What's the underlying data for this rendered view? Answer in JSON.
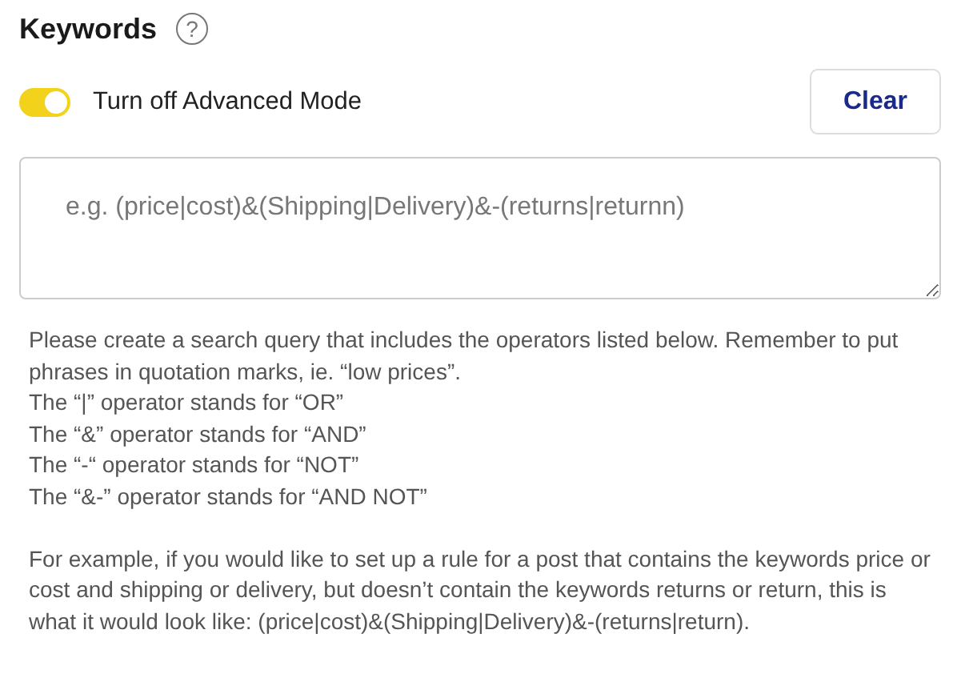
{
  "title": "Keywords",
  "help_icon": "?",
  "toggle": {
    "label": "Turn off Advanced Mode",
    "on": true
  },
  "clear_button": "Clear",
  "query_field": {
    "placeholder": "e.g. (price|cost)&(Shipping|Delivery)&-(returns|returnn)"
  },
  "instructions": [
    "Please create a search query that includes the operators listed below. Remember to put phrases in quotation marks, ie. “low prices”.",
    "The “|” operator stands for “OR”",
    "The “&” operator stands for “AND”",
    "The “-“ operator stands for “NOT”",
    "The “&-” operator stands for “AND NOT”"
  ],
  "example": "For example, if you would like to set up a rule for a post that contains the keywords price or cost and shipping or delivery, but doesn’t contain the keywords returns or return, this is what it would look like: (price|cost)&(Shipping|Delivery)&-(returns|return)."
}
